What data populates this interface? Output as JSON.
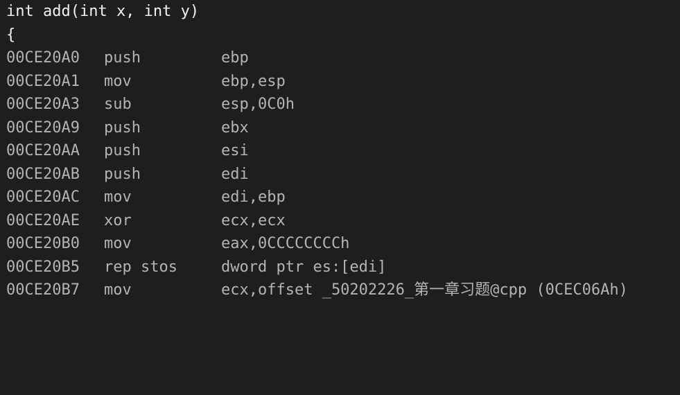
{
  "source_lines": [
    "int add(int x, int y)",
    "{"
  ],
  "instructions": [
    {
      "address": "00CE20A0",
      "mnemonic": "push",
      "operands": "ebp"
    },
    {
      "address": "00CE20A1",
      "mnemonic": "mov",
      "operands": "ebp,esp"
    },
    {
      "address": "00CE20A3",
      "mnemonic": "sub",
      "operands": "esp,0C0h"
    },
    {
      "address": "00CE20A9",
      "mnemonic": "push",
      "operands": "ebx"
    },
    {
      "address": "00CE20AA",
      "mnemonic": "push",
      "operands": "esi"
    },
    {
      "address": "00CE20AB",
      "mnemonic": "push",
      "operands": "edi"
    },
    {
      "address": "00CE20AC",
      "mnemonic": "mov",
      "operands": "edi,ebp"
    },
    {
      "address": "00CE20AE",
      "mnemonic": "xor",
      "operands": "ecx,ecx"
    },
    {
      "address": "00CE20B0",
      "mnemonic": "mov",
      "operands": "eax,0CCCCCCCCh"
    },
    {
      "address": "00CE20B5",
      "mnemonic": "rep stos",
      "operands": "dword ptr es:[edi]"
    },
    {
      "address": "00CE20B7",
      "mnemonic": "mov",
      "operands": "ecx,offset _50202226_第一章习题@cpp (0CEC06Ah)"
    }
  ],
  "colors": {
    "background": "#1e1e1e",
    "source_text": "#f2f2f2",
    "asm_text": "#b4b4b4"
  }
}
